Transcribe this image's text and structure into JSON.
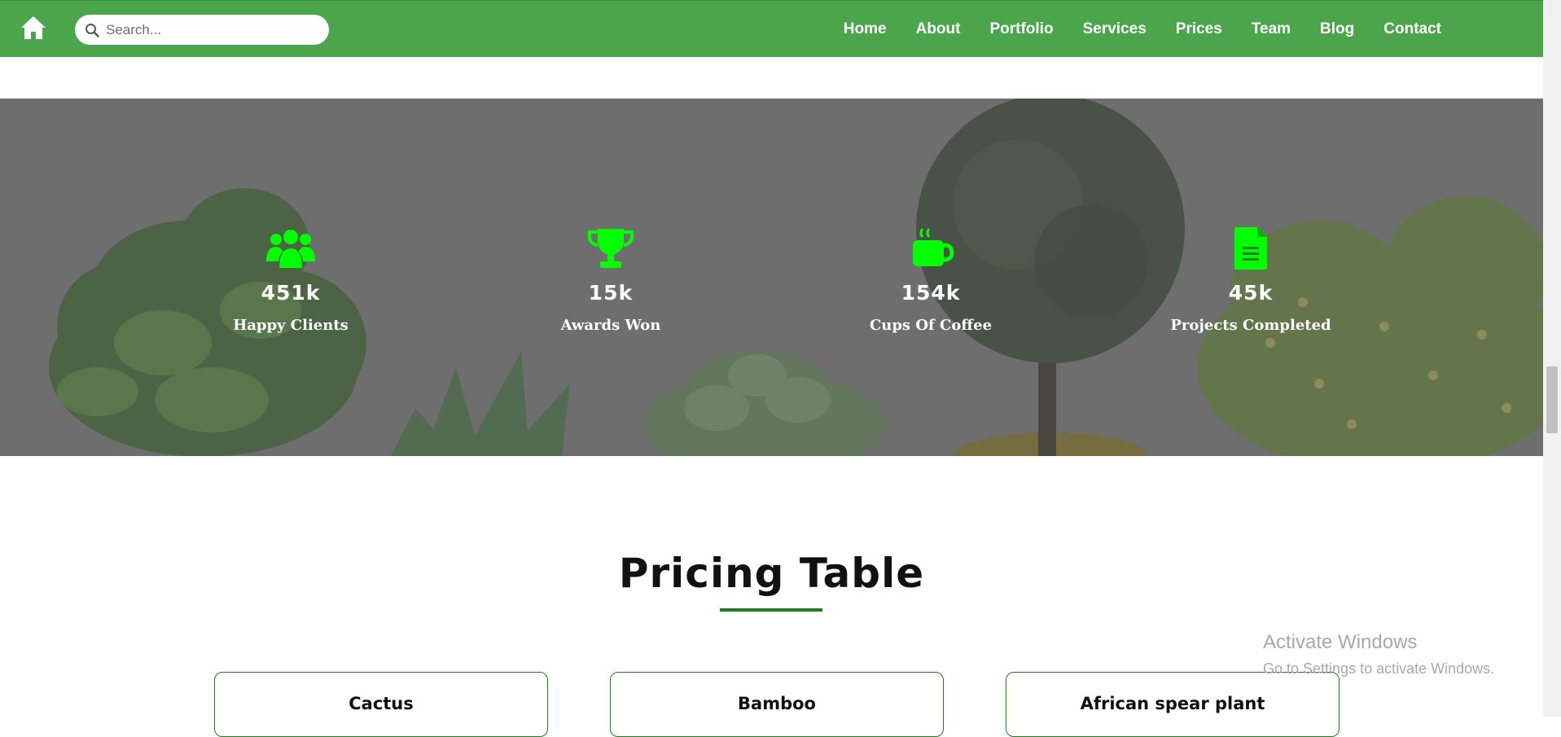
{
  "nav": {
    "search_placeholder": "Search...",
    "links": [
      "Home",
      "About",
      "Portfolio",
      "Services",
      "Prices",
      "Team",
      "Blog",
      "Contact"
    ]
  },
  "stats": [
    {
      "icon": "users-icon",
      "value": "451k",
      "label": "Happy Clients"
    },
    {
      "icon": "trophy-icon",
      "value": "15k",
      "label": "Awards Won"
    },
    {
      "icon": "coffee-cup-icon",
      "value": "154k",
      "label": "Cups Of Coffee"
    },
    {
      "icon": "document-icon",
      "value": "45k",
      "label": "Projects Completed"
    }
  ],
  "pricing": {
    "title": "Pricing Table",
    "cards": [
      {
        "name": "Cactus"
      },
      {
        "name": "Bamboo"
      },
      {
        "name": "African spear plant"
      }
    ]
  },
  "watermark": {
    "title": "Activate Windows",
    "subtitle": "Go to Settings to activate Windows."
  },
  "colors": {
    "navbar": "#4ba64b",
    "icon_green": "#00ff00",
    "accent_green": "#1e7d1e",
    "overlay_gray": "#7d7d7d"
  }
}
